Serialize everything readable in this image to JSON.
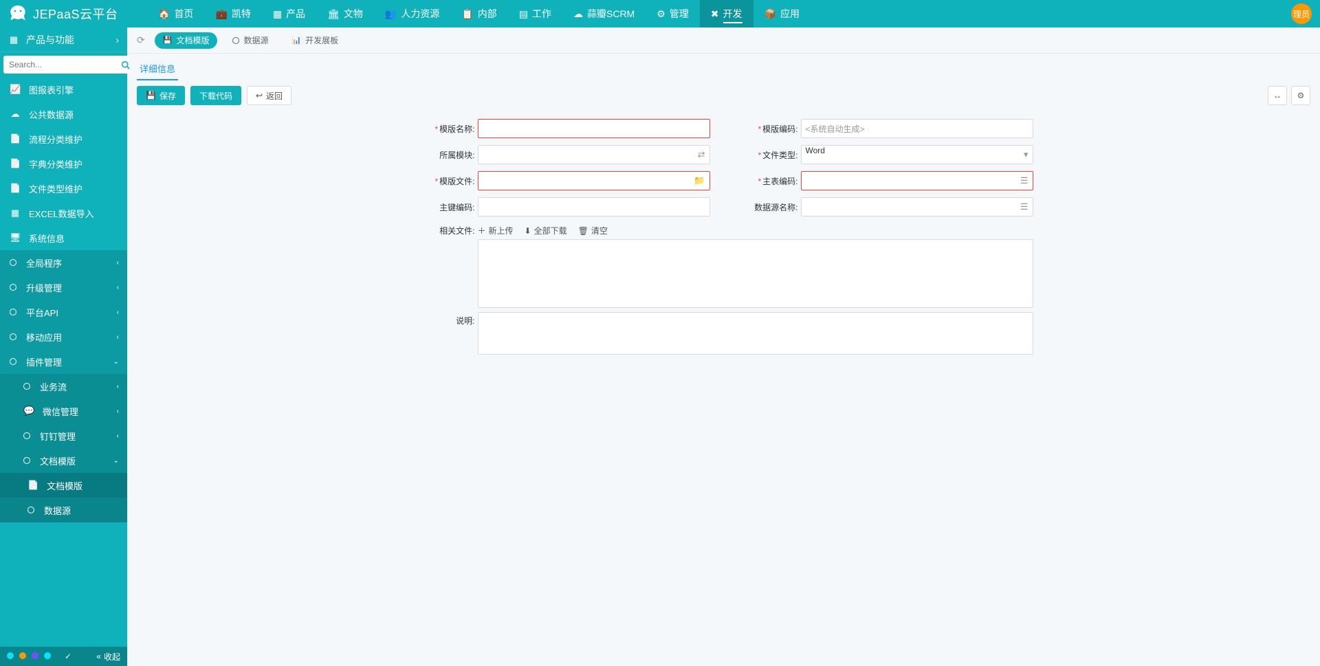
{
  "app": {
    "name": "JEPaaS云平台",
    "avatar": "理员"
  },
  "topnav": [
    {
      "icon": "home",
      "label": "首页"
    },
    {
      "icon": "briefcase",
      "label": "凯特"
    },
    {
      "icon": "grid",
      "label": "产品"
    },
    {
      "icon": "bank",
      "label": "文物"
    },
    {
      "icon": "users",
      "label": "人力资源"
    },
    {
      "icon": "calendar",
      "label": "内部"
    },
    {
      "icon": "work",
      "label": "工作"
    },
    {
      "icon": "cloud",
      "label": "蒜瓣SCRM"
    },
    {
      "icon": "gear",
      "label": "管理"
    },
    {
      "icon": "wrench",
      "label": "开发",
      "active": true
    },
    {
      "icon": "cube",
      "label": "应用"
    }
  ],
  "sidebar": {
    "header": "产品与功能",
    "search_placeholder": "Search...",
    "items": [
      {
        "type": "item",
        "icon": "chart",
        "label": "图报表引擎"
      },
      {
        "type": "item",
        "icon": "cloud",
        "label": "公共数据源"
      },
      {
        "type": "item",
        "icon": "doc",
        "label": "流程分类维护"
      },
      {
        "type": "item",
        "icon": "doc",
        "label": "字典分类维护"
      },
      {
        "type": "item",
        "icon": "file",
        "label": "文件类型维护"
      },
      {
        "type": "item",
        "icon": "xls",
        "label": "EXCEL数据导入"
      },
      {
        "type": "item",
        "icon": "monitor",
        "label": "系统信息"
      },
      {
        "type": "group",
        "label": "全局程序",
        "chev": "left"
      },
      {
        "type": "group",
        "label": "升级管理",
        "chev": "left"
      },
      {
        "type": "group",
        "label": "平台API",
        "chev": "left"
      },
      {
        "type": "group",
        "label": "移动应用",
        "chev": "left"
      },
      {
        "type": "group",
        "label": "插件管理",
        "chev": "down",
        "expanded": true
      },
      {
        "type": "sub",
        "label": "业务流",
        "chev": "left"
      },
      {
        "type": "sub",
        "icon": "wechat",
        "label": "微信管理",
        "chev": "left"
      },
      {
        "type": "sub",
        "label": "钉钉管理",
        "chev": "left"
      },
      {
        "type": "sub",
        "label": "文档模版",
        "chev": "down",
        "expanded": true
      },
      {
        "type": "sub-leaf",
        "icon": "doc",
        "label": "文档模版",
        "active": true
      },
      {
        "type": "sub-leaf",
        "icon": "o",
        "label": "数据源"
      }
    ],
    "footer": {
      "dots": [
        "#00e5ff",
        "#ff9800",
        "#7c4dff",
        "#00e5ff"
      ],
      "check": true,
      "collapse": "收起"
    }
  },
  "tabs": [
    {
      "icon": "save",
      "label": "文档模版",
      "active": true
    },
    {
      "icon": "circle",
      "label": "数据源"
    },
    {
      "icon": "dash",
      "label": "开发展板"
    }
  ],
  "subtab": {
    "label": "详细信息"
  },
  "toolbar": {
    "save": "保存",
    "download": "下载代码",
    "back": "返回"
  },
  "form": {
    "rows": {
      "tpl_name": {
        "label": "模版名称:",
        "required": true,
        "error": true
      },
      "tpl_code": {
        "label": "模版编码:",
        "required": true,
        "placeholder": "<系统自动生成>"
      },
      "module": {
        "label": "所属模块:",
        "required": false,
        "suffix": "share"
      },
      "file_type": {
        "label": "文件类型:",
        "required": true,
        "value": "Word",
        "suffix": "dropdown"
      },
      "tpl_file": {
        "label": "模版文件:",
        "required": true,
        "error": true,
        "suffix": "folder"
      },
      "main_table": {
        "label": "主表编码:",
        "required": true,
        "error": true,
        "suffix": "list"
      },
      "pk_code": {
        "label": "主键编码:",
        "required": false
      },
      "ds_name": {
        "label": "数据源名称:",
        "required": false,
        "suffix": "list"
      },
      "rel_files": {
        "label": "相关文件:"
      },
      "desc": {
        "label": "说明:"
      }
    },
    "file_toolbar": {
      "upload": "新上传",
      "download_all": "全部下载",
      "clear": "清空"
    }
  }
}
